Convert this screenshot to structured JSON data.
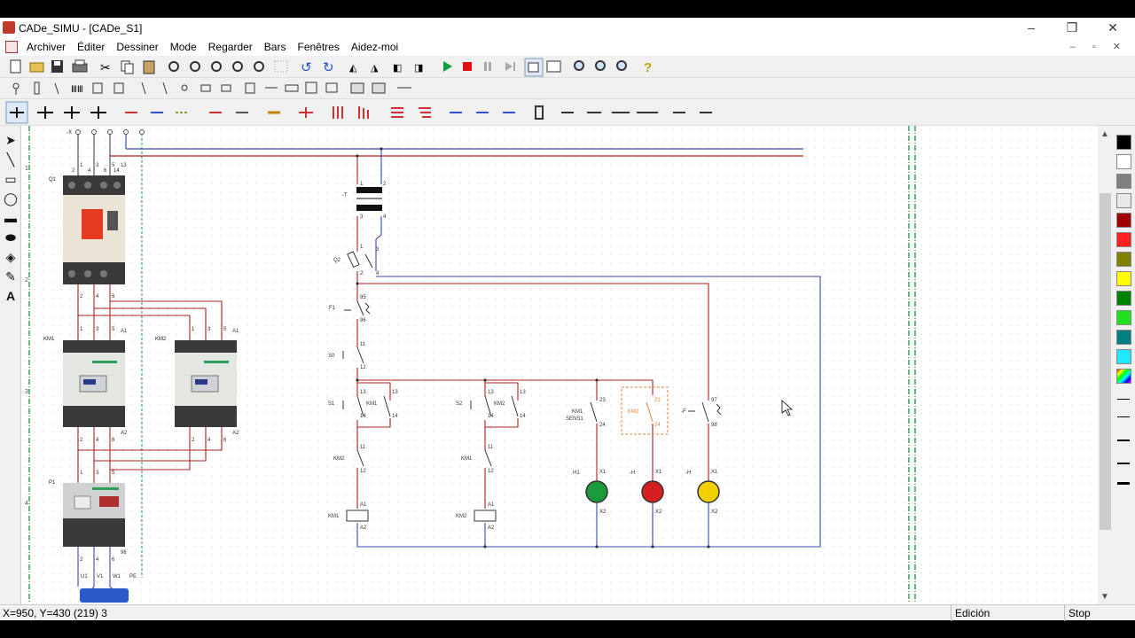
{
  "window": {
    "title": "CADe_SIMU - [CADe_S1]",
    "minimize": "–",
    "restore": "❐",
    "close": "✕"
  },
  "menu": {
    "items": [
      "Archiver",
      "Éditer",
      "Dessiner",
      "Mode",
      "Regarder",
      "Bars",
      "Fenêtres",
      "Aidez-moi"
    ],
    "mdi_controls": "– ▫ ✕"
  },
  "canvas": {
    "power": {
      "top_terminal": "-X",
      "q1": "Q1",
      "q1_top": [
        "1",
        "3",
        "5",
        "13"
      ],
      "q1_top2": [
        "2",
        "4",
        "6",
        "14"
      ],
      "q1_bottom": [
        "2",
        "4",
        "6"
      ],
      "km1": "KM1",
      "km2": "KM2",
      "km_top": [
        "1",
        "3",
        "5"
      ],
      "a1": "A1",
      "a2": "A2",
      "km_bottom": [
        "2",
        "4",
        "6"
      ],
      "p1": "P1",
      "p1_top": [
        "1",
        "3",
        "5"
      ],
      "p1_bottom": [
        "2",
        "4",
        "6"
      ],
      "p1_aux": "96",
      "motor": [
        "U1",
        "V1",
        "W1",
        "PE"
      ]
    },
    "control": {
      "t": "-T",
      "t_pins": [
        "1",
        "2",
        "3",
        "4"
      ],
      "q2": "Q2",
      "q2_pins": [
        "1",
        "2",
        "3",
        "4"
      ],
      "f1": "F1",
      "f1_pins": [
        "95",
        "96"
      ],
      "s0": "S0",
      "s0_pins": [
        "11",
        "12"
      ],
      "s1": "S1",
      "s2": "S2",
      "no_pins": [
        "13",
        "14"
      ],
      "km1": "KM1",
      "km2": "KM2",
      "km1_sens": "KM1\nSENS1",
      "nc_pins": [
        "11",
        "12"
      ],
      "aux_pins": [
        "23",
        "24"
      ],
      "f_label": "-F",
      "f_pins": [
        "97",
        "98"
      ],
      "h1": "H1",
      "h": "-H",
      "x1": "X1",
      "x2": "X2",
      "coil_pins": [
        "A1",
        "A2"
      ]
    },
    "margin_rows": [
      "1",
      "2",
      "3",
      "4"
    ]
  },
  "status": {
    "coords": "X=950, Y=430 (219) 3",
    "mode": "Edición",
    "run": "Stop"
  },
  "colors": {
    "wire_red": "#b02020",
    "wire_blue": "#3a4ab0",
    "lamp_green": "#1a9a3a",
    "lamp_red": "#d62020",
    "lamp_yellow": "#f2d000",
    "aux_orange": "#e08040"
  },
  "palette": [
    "#000000",
    "#ffffff",
    "#808080",
    "#e8e8e8",
    "#a00000",
    "#ff2020",
    "#808000",
    "#ffff00",
    "#008000",
    "#20e020",
    "#008080",
    "#20e8ff"
  ]
}
